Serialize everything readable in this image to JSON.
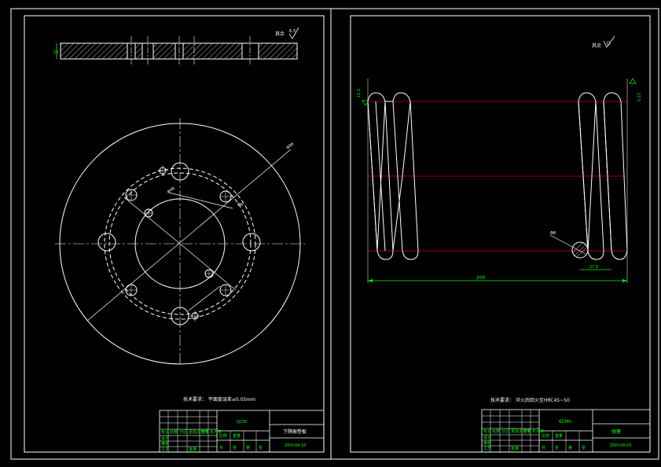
{
  "colors": {
    "background": "#000000",
    "line": "#ffffff",
    "dimension": "#00ff00",
    "centerline_red": "#cc0000",
    "note_text": "#ffffff"
  },
  "left_sheet": {
    "roughness_note": "其余",
    "roughness_value": "6.3",
    "section_thickness_label": "10",
    "diameter_label": "Φ96",
    "pcd_label": "Φ48",
    "hole_label": "Φ6",
    "tech_note": "技术要求：  平面度误差≤0.05mm",
    "title_block": {
      "material": "Q235",
      "part_name": "下隔振垫板",
      "drawing_no": "ZDH-09-10",
      "cells": [
        "标记",
        "处数",
        "分区",
        "更改文件号",
        "签名",
        "年月日",
        "设计",
        "审核",
        "工艺",
        "批准",
        "共",
        "张",
        "第",
        "张",
        "比例",
        "重量"
      ]
    }
  },
  "right_sheet": {
    "roughness_note": "其余",
    "left_roughness": "12.5",
    "right_roughness": "12.5",
    "length_dim": "200",
    "pitch_dim": "27.5",
    "wire_dia_label": "Φ8",
    "tech_note": "技术要求：  淬火后回火至HRC45~50",
    "title_block": {
      "material": "65Mn",
      "part_name": "弹簧",
      "drawing_no": "ZDH-09-03",
      "cells": [
        "标记",
        "处数",
        "分区",
        "更改文件号",
        "签名",
        "年月日",
        "设计",
        "审核",
        "工艺",
        "批准",
        "共",
        "张",
        "第",
        "张",
        "比例",
        "重量"
      ]
    }
  }
}
